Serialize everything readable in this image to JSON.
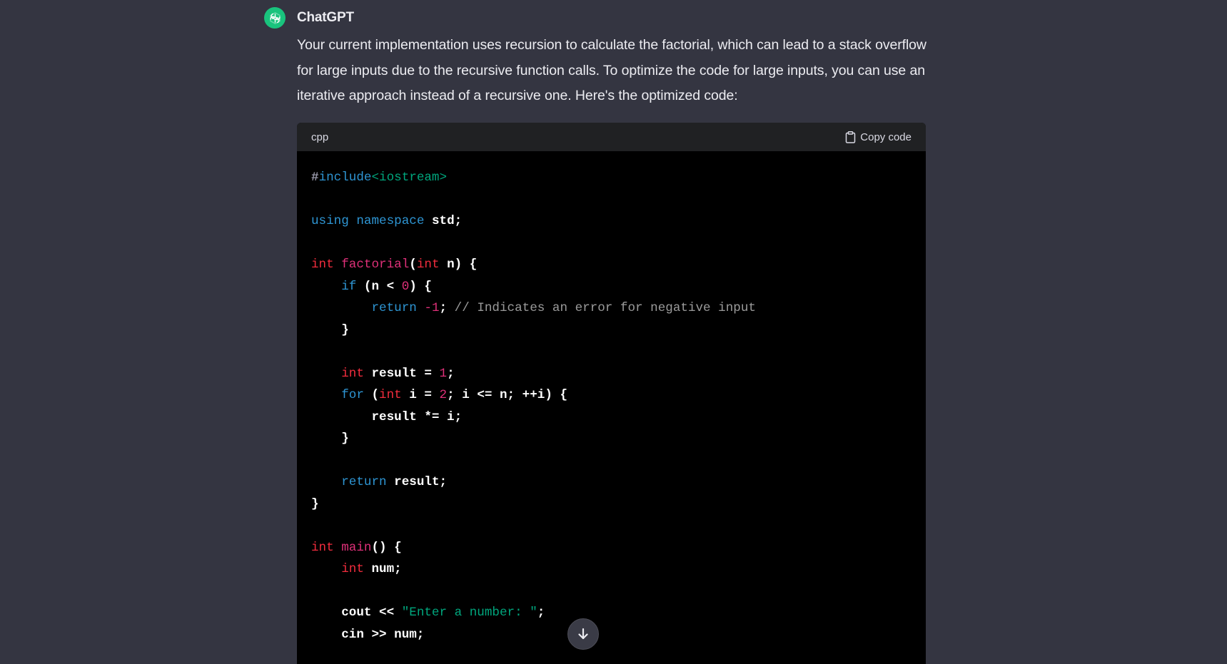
{
  "message": {
    "sender": "ChatGPT",
    "avatar_icon": "openai-logo-icon",
    "avatar_color": "#19c37d",
    "intro_text": "Your current implementation uses recursion to calculate the factorial, which can lead to a stack overflow for large inputs due to the recursive function calls. To optimize the code for large inputs, you can use an iterative approach instead of a recursive one. Here's the optimized code:"
  },
  "code_block": {
    "language": "cpp",
    "copy_label": "Copy code",
    "lines": [
      [
        {
          "t": "#",
          "c": "meta"
        },
        {
          "t": "include",
          "c": "include"
        },
        {
          "t": "<iostream>",
          "c": "string"
        }
      ],
      [],
      [
        {
          "t": "using",
          "c": "keyword"
        },
        {
          "t": " ",
          "c": "plain"
        },
        {
          "t": "namespace",
          "c": "keyword"
        },
        {
          "t": " std;",
          "c": "plain"
        }
      ],
      [],
      [
        {
          "t": "int",
          "c": "type"
        },
        {
          "t": " ",
          "c": "plain"
        },
        {
          "t": "factorial",
          "c": "func"
        },
        {
          "t": "(",
          "c": "plain"
        },
        {
          "t": "int",
          "c": "type"
        },
        {
          "t": " n) {",
          "c": "plain"
        }
      ],
      [
        {
          "t": "    ",
          "c": "plain"
        },
        {
          "t": "if",
          "c": "keyword"
        },
        {
          "t": " (n < ",
          "c": "plain"
        },
        {
          "t": "0",
          "c": "number"
        },
        {
          "t": ") {",
          "c": "plain"
        }
      ],
      [
        {
          "t": "        ",
          "c": "plain"
        },
        {
          "t": "return",
          "c": "keyword"
        },
        {
          "t": " ",
          "c": "plain"
        },
        {
          "t": "-1",
          "c": "number"
        },
        {
          "t": "; ",
          "c": "plain"
        },
        {
          "t": "// Indicates an error for negative input",
          "c": "comment"
        }
      ],
      [
        {
          "t": "    }",
          "c": "plain"
        }
      ],
      [],
      [
        {
          "t": "    ",
          "c": "plain"
        },
        {
          "t": "int",
          "c": "type"
        },
        {
          "t": " result = ",
          "c": "plain"
        },
        {
          "t": "1",
          "c": "number"
        },
        {
          "t": ";",
          "c": "plain"
        }
      ],
      [
        {
          "t": "    ",
          "c": "plain"
        },
        {
          "t": "for",
          "c": "keyword"
        },
        {
          "t": " (",
          "c": "plain"
        },
        {
          "t": "int",
          "c": "type"
        },
        {
          "t": " i = ",
          "c": "plain"
        },
        {
          "t": "2",
          "c": "number"
        },
        {
          "t": "; i <= n; ++i) {",
          "c": "plain"
        }
      ],
      [
        {
          "t": "        result *= i;",
          "c": "plain"
        }
      ],
      [
        {
          "t": "    }",
          "c": "plain"
        }
      ],
      [],
      [
        {
          "t": "    ",
          "c": "plain"
        },
        {
          "t": "return",
          "c": "keyword"
        },
        {
          "t": " result;",
          "c": "plain"
        }
      ],
      [
        {
          "t": "}",
          "c": "plain"
        }
      ],
      [],
      [
        {
          "t": "int",
          "c": "type"
        },
        {
          "t": " ",
          "c": "plain"
        },
        {
          "t": "main",
          "c": "func"
        },
        {
          "t": "() {",
          "c": "plain"
        }
      ],
      [
        {
          "t": "    ",
          "c": "plain"
        },
        {
          "t": "int",
          "c": "type"
        },
        {
          "t": " num;",
          "c": "plain"
        }
      ],
      [],
      [
        {
          "t": "    cout << ",
          "c": "plain"
        },
        {
          "t": "\"Enter a number: \"",
          "c": "string"
        },
        {
          "t": ";",
          "c": "plain"
        }
      ],
      [
        {
          "t": "    cin >> num;",
          "c": "plain"
        }
      ]
    ]
  },
  "scroll_button": {
    "icon": "arrow-down-icon"
  },
  "colors": {
    "background": "#343541",
    "code_background": "#000000",
    "code_header": "#202123",
    "keyword": "#2e95d3",
    "type": "#f22c3d",
    "func": "#df3079",
    "string": "#00a67d"
  }
}
